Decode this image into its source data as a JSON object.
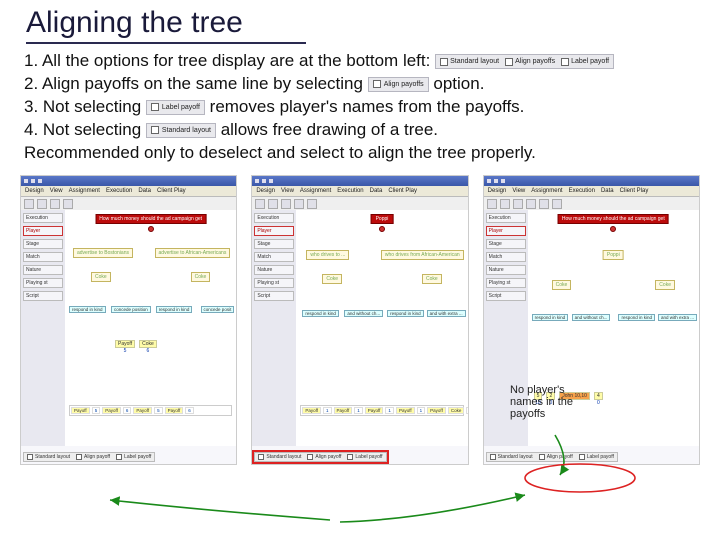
{
  "title": "Aligning the tree",
  "lines": {
    "l1a": "1. All the options for tree display are at the bottom left:",
    "l2a": "2. Align payoffs on the same line by selecting ",
    "l2b": " option.",
    "l3a": "3. Not selecting ",
    "l3b": " removes player's names from the payoffs.",
    "l4a": "4. Not selecting ",
    "l4b": " allows free drawing of a tree.",
    "rec": "Recommended only to deselect and select to align the tree properly."
  },
  "chips": {
    "group_a": "Standard layout",
    "group_b": "Align payoffs",
    "group_c": "Label payoff",
    "align": "Align payoffs",
    "label": "Label payoff",
    "std": "Standard layout"
  },
  "menus": [
    "Design",
    "View",
    "Assignment",
    "Execution",
    "Data",
    "Client Play"
  ],
  "side_tabs": [
    "Execution",
    "Player",
    "Stage",
    "Match",
    "Nature",
    "Playing st",
    "Script"
  ],
  "panel_root_long": "How much money should the ad campaign get",
  "panel_root_short": "Poppi",
  "branch_labels": {
    "l1_left": "advertise to Bostonians",
    "l1_right": "advertise to African-Americans"
  },
  "mid_node": "Coke",
  "leaves": {
    "a": "respond in kind",
    "b": "concede position",
    "c": "respond in kind",
    "d": "concede posit"
  },
  "leaves2": {
    "a": "who drives to ...",
    "b": "who drives from African-American"
  },
  "leaves3": {
    "a": "and without ch...",
    "b": "and with extra ...",
    "c": "respond in kind",
    "d": "and with extra ..."
  },
  "payoff_names": [
    "Payoff",
    "Coke",
    "Payoff",
    "Coke",
    "Payoff",
    "Coke",
    "Payoff",
    "Coke"
  ],
  "payoff_row2": [
    "Payoff",
    "1",
    "Payoff",
    "1",
    "Payoff",
    "1",
    "Payoff",
    "1",
    "Payoff",
    "Coke",
    "1"
  ],
  "payoff_strip3": [
    {
      "t": "5",
      "v": "10"
    },
    {
      "t": "2",
      "v": "0"
    },
    {
      "t": "John 10,10",
      "v": ""
    },
    {
      "t": "4",
      "v": "0"
    }
  ],
  "bottom_opts": [
    "Standard layout",
    "Align payoff",
    "Label payoff"
  ],
  "callout": "No player's names in the payoffs"
}
